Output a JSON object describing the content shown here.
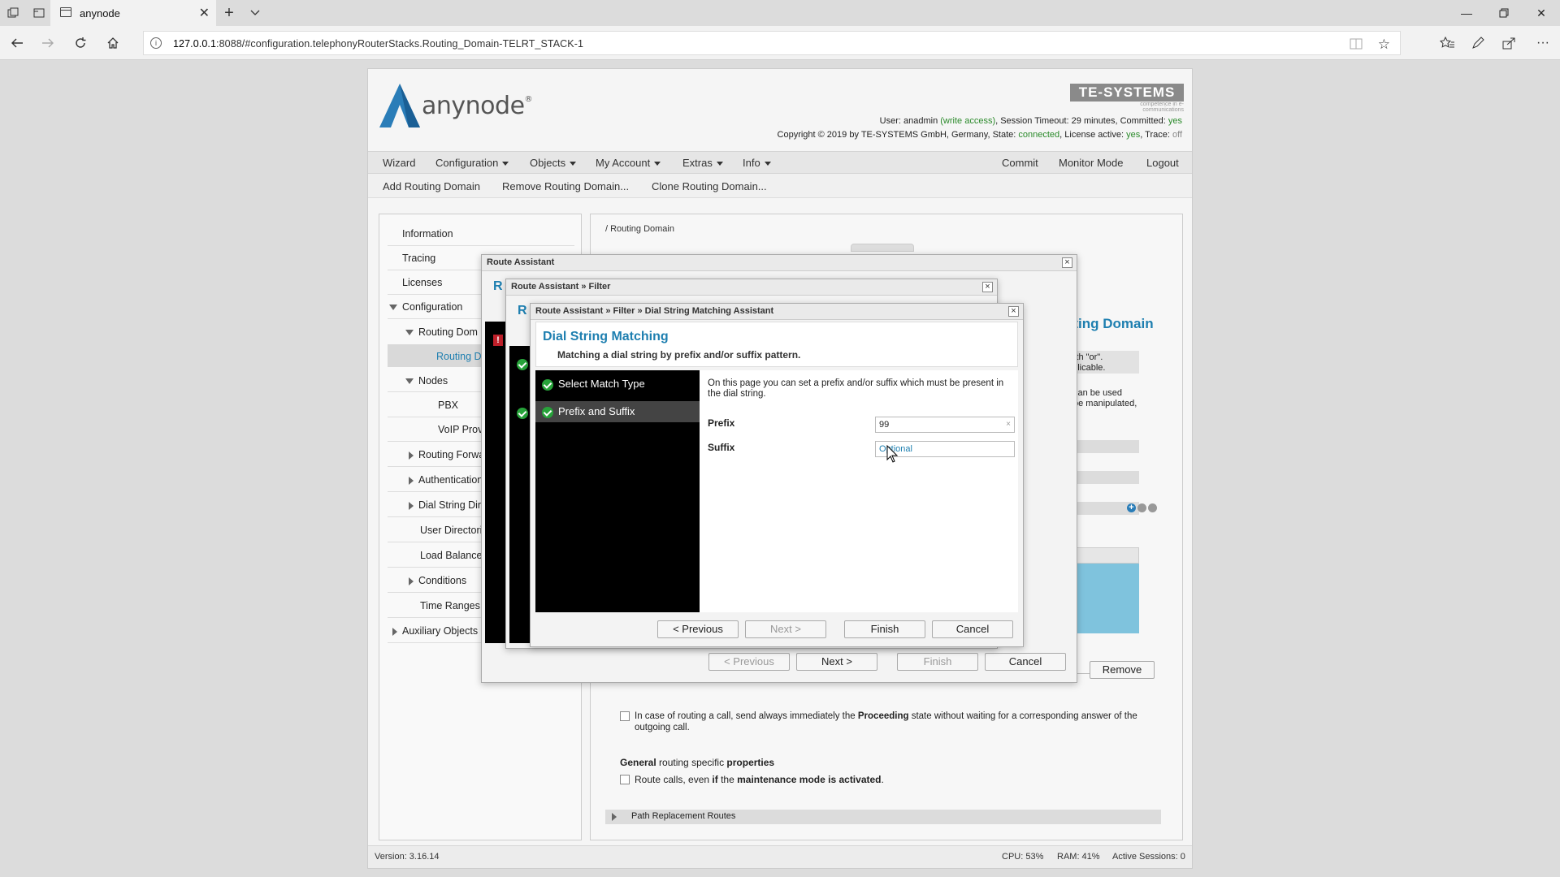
{
  "browser": {
    "tab_title": "anynode",
    "url_host": "127.0.0.1",
    "url_rest": ":8088/#configuration.telephonyRouterStacks.Routing_Domain-TELRT_STACK-1"
  },
  "header": {
    "logo_text": "anynode",
    "logo_reg": "®",
    "vendor": "TE-SYSTEMS",
    "vendor_tagline": "competence in e-communications",
    "user_prefix": "User:",
    "user": "anadmin",
    "access": "(write access)",
    "session": ", Session Timeout: 29 minutes, Committed:",
    "committed": "yes",
    "copyright": "Copyright © 2019 by TE-SYSTEMS GmbH, Germany, State:",
    "state": "connected",
    "license": ", License active:",
    "license_val": "yes",
    "trace": ", Trace:",
    "trace_val": "off"
  },
  "menu": {
    "items": [
      "Wizard",
      "Configuration",
      "Objects",
      "My Account",
      "Extras",
      "Info"
    ],
    "right": [
      "Commit",
      "Monitor Mode",
      "Logout"
    ],
    "sub": [
      "Add Routing Domain",
      "Remove Routing Domain...",
      "Clone Routing Domain..."
    ]
  },
  "tree": {
    "items": [
      "Information",
      "Tracing",
      "Licenses",
      "Configuration",
      "Routing Dom",
      "Routing D",
      "Nodes",
      "PBX",
      "VoIP Provi",
      "Routing Forwa",
      "Authentication",
      "Dial String Dir",
      "User Directori",
      "Load Balance",
      "Conditions",
      "Time Ranges",
      "Auxiliary Objects"
    ]
  },
  "content": {
    "breadcrumb": "/ Routing Domain",
    "heading_frag": "uting Domain",
    "frag1": "an",
    "frag2": "with \"or\".",
    "frag3": "pplicable.",
    "frag4": "can be used",
    "frag5": "be manipulated,",
    "frag_ove": "ove",
    "remove_button": "Remove",
    "proceeding_text_a": "In case of routing a call, send always immediately the ",
    "proceeding_bold": "Proceeding",
    "proceeding_text_b": " state without waiting for a corresponding answer of the outgoing call.",
    "general_a": "General",
    "general_b": " routing specific ",
    "general_c": "properties",
    "maint_a": "Route calls, even ",
    "maint_b": "if",
    "maint_c": " the ",
    "maint_d": "maintenance mode is activated",
    "maint_e": ".",
    "path_replacement": "Path Replacement Routes"
  },
  "footer": {
    "version": "Version: 3.16.14",
    "cpu": "CPU: 53%",
    "ram": "RAM: 41%",
    "sessions": "Active Sessions: 0"
  },
  "dialog1": {
    "title": "Route Assistant",
    "frag_r": "R",
    "buttons": {
      "previous": "< Previous",
      "next": "Next >",
      "finish": "Finish",
      "cancel": "Cancel"
    }
  },
  "dialog2": {
    "title": "Route Assistant » Filter",
    "frag_r": "R"
  },
  "dialog3": {
    "title": "Route Assistant » Filter » Dial String Matching Assistant",
    "heading": "Dial String Matching",
    "subheading": "Matching a dial string by prefix and/or suffix pattern.",
    "steps": [
      "Select Match Type",
      "Prefix and Suffix"
    ],
    "description": "On this page you can set a prefix and/or suffix which must be present in the dial string.",
    "prefix_label": "Prefix",
    "prefix_value": "99",
    "suffix_label": "Suffix",
    "suffix_placeholder": "Optional",
    "buttons": {
      "previous": "< Previous",
      "next": "Next >",
      "finish": "Finish",
      "cancel": "Cancel"
    }
  },
  "colors": {
    "accent_blue": "#1e7fb0",
    "check_green": "#27a33a",
    "selected_blue": "#7fc3dd"
  }
}
